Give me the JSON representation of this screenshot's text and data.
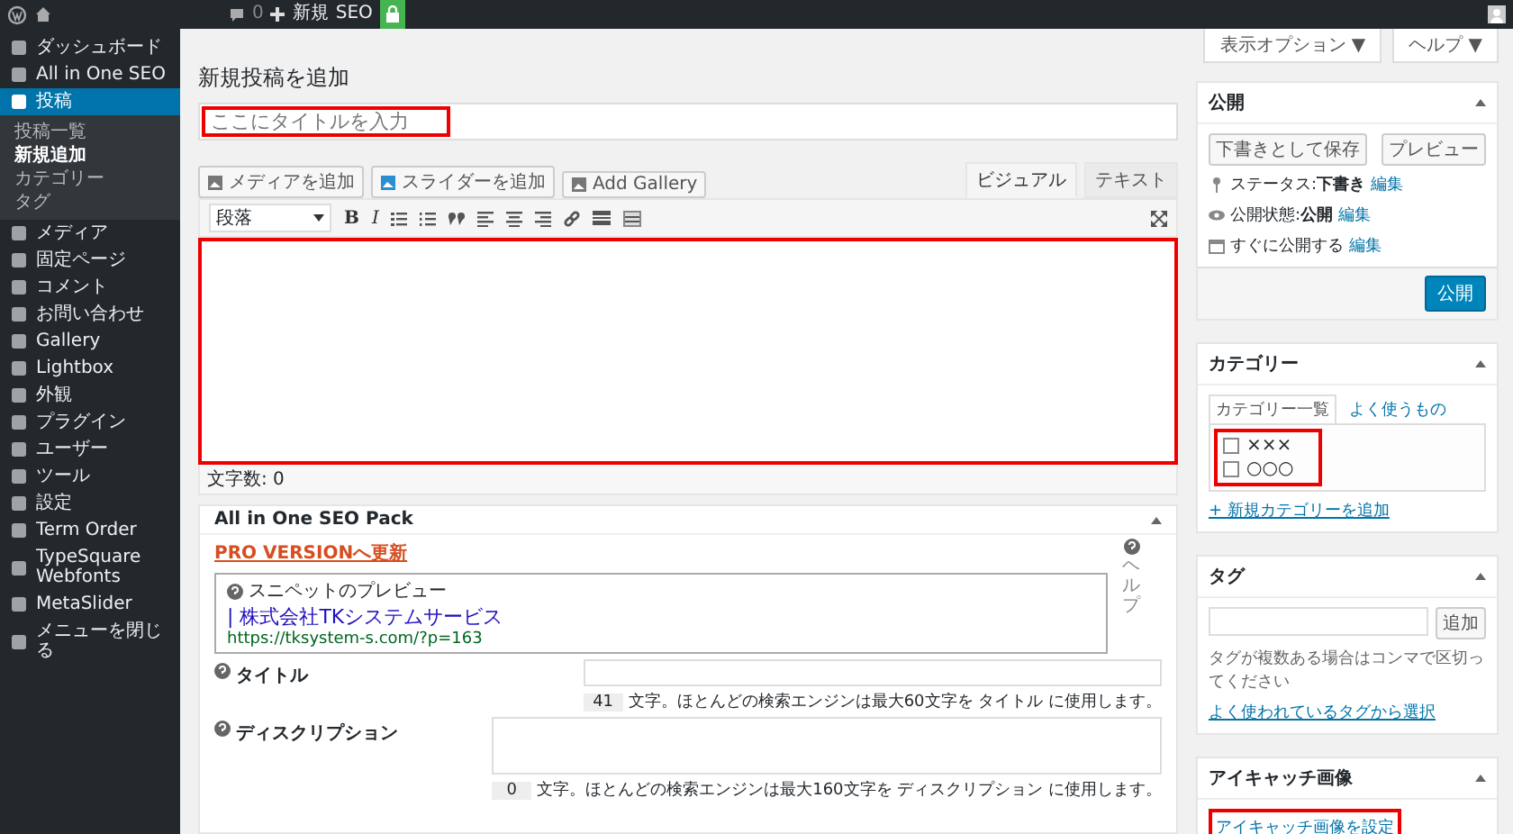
{
  "admin_bar": {
    "comments_count": "0",
    "new_label": "新規",
    "seo_label": "SEO"
  },
  "sidebar": {
    "items": [
      {
        "label": "ダッシュボード",
        "selected": false
      },
      {
        "label": "All in One SEO",
        "selected": false
      },
      {
        "label": "投稿",
        "selected": true,
        "children": [
          {
            "label": "投稿一覧",
            "selected": false
          },
          {
            "label": "新規追加",
            "selected": true
          },
          {
            "label": "カテゴリー",
            "selected": false
          },
          {
            "label": "タグ",
            "selected": false
          }
        ]
      },
      {
        "label": "メディア",
        "selected": false
      },
      {
        "label": "固定ページ",
        "selected": false
      },
      {
        "label": "コメント",
        "selected": false
      },
      {
        "label": "お問い合わせ",
        "selected": false
      },
      {
        "label": "Gallery",
        "selected": false
      },
      {
        "label": "Lightbox",
        "selected": false
      },
      {
        "label": "外観",
        "selected": false
      },
      {
        "label": "プラグイン",
        "selected": false
      },
      {
        "label": "ユーザー",
        "selected": false
      },
      {
        "label": "ツール",
        "selected": false
      },
      {
        "label": "設定",
        "selected": false
      },
      {
        "label": "Term Order",
        "selected": false
      },
      {
        "label": "TypeSquare Webfonts",
        "selected": false
      },
      {
        "label": "MetaSlider",
        "selected": false
      },
      {
        "label": "メニューを閉じる",
        "selected": false
      }
    ]
  },
  "screen_buttons": [
    "表示オプション ▼",
    "ヘルプ ▼"
  ],
  "page_title": "新規投稿を追加",
  "title_field": {
    "placeholder": "ここにタイトルを入力"
  },
  "media_buttons": [
    "メディアを追加",
    "スライダーを追加",
    "Add Gallery"
  ],
  "editor_tabs": [
    {
      "label": "ビジュアル",
      "selected": true
    },
    {
      "label": "テキスト",
      "selected": false
    }
  ],
  "toolbar": {
    "format": "段落",
    "bold": "B",
    "italic": "I"
  },
  "word_count": "文字数: 0",
  "seo_box": {
    "title": "All in One SEO Pack",
    "pro_link": "PRO VERSIONへ更新",
    "help_label": "ヘルプ",
    "snippet": {
      "label": "スニペットのプレビュー",
      "title": "| 株式会社TKシステムサービス",
      "url": "https://tksystem-s.com/?p=163"
    },
    "fields": [
      {
        "label": "タイトル",
        "kind": "input",
        "count": "41",
        "note": "文字。ほとんどの検索エンジンは最大60文字を タイトル に使用します。"
      },
      {
        "label": "ディスクリプション",
        "kind": "textarea",
        "count": "0",
        "note": "文字。ほとんどの検索エンジンは最大160文字を ディスクリプション に使用します。"
      }
    ]
  },
  "publish": {
    "title": "公開",
    "save_draft": "下書きとして保存",
    "preview": "プレビュー",
    "rows": [
      {
        "label": "ステータス:",
        "value": "下書き",
        "link": "編集"
      },
      {
        "label": "公開状態:",
        "value": "公開",
        "link": "編集"
      },
      {
        "label": "すぐに公開する",
        "link": "編集"
      }
    ],
    "publish_button": "公開"
  },
  "categories": {
    "title": "カテゴリー",
    "tabs": [
      {
        "label": "カテゴリー一覧",
        "selected": true
      },
      {
        "label": "よく使うもの",
        "selected": false
      }
    ],
    "items": [
      {
        "label": "×××",
        "checked": false
      },
      {
        "label": "○○○",
        "checked": false
      }
    ],
    "add_link": "+ 新規カテゴリーを追加"
  },
  "tags": {
    "title": "タグ",
    "add_button": "追加",
    "hint": "タグが複数ある場合はコンマで区切ってください",
    "link": "よく使われているタグから選択"
  },
  "featured_image": {
    "title": "アイキャッチ画像",
    "link": "アイキャッチ画像を設定"
  }
}
